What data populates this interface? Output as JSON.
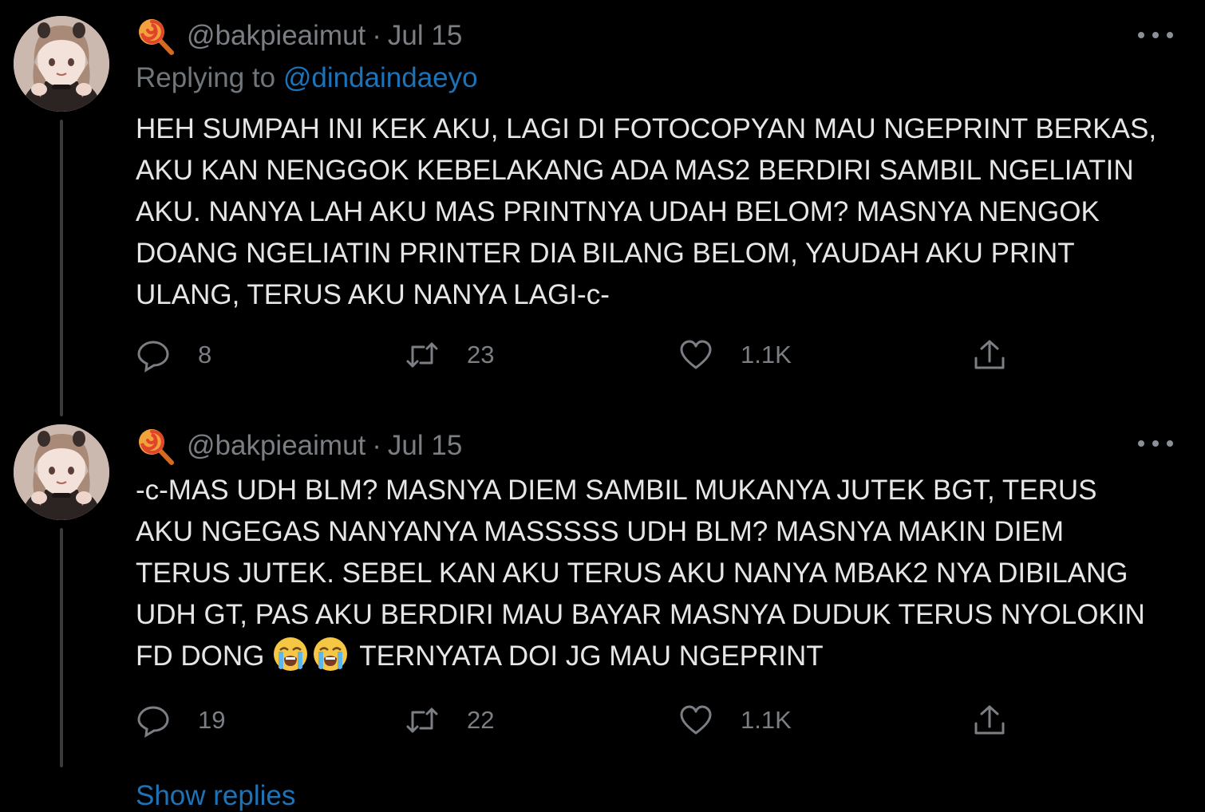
{
  "colors": {
    "background": "#000000",
    "text_primary": "#e6e6e6",
    "text_secondary": "#7b7f84",
    "link": "#1d73b8",
    "thread_line": "#3a3a3a"
  },
  "tweets": [
    {
      "handle": "@bakpieaimut",
      "separator": "·",
      "date": "Jul 15",
      "replying_label": "Replying to",
      "replying_to": "@dindaindaeyo",
      "lines": [
        "HEH SUMPAH INI KEK AKU, LAGI DI FOTOCOPYAN MAU NGEPRINT BERKAS,",
        "AKU KAN NENGGOK KEBELAKANG ADA MAS2 BERDIRI SAMBIL NGELIATIN",
        "AKU. NANYA LAH AKU MAS PRINTNYA UDAH BELOM? MASNYA NENGOK",
        "DOANG NGELIATIN PRINTER DIA BILANG BELOM, YAUDAH AKU PRINT",
        "ULANG, TERUS AKU NANYA LAGI-c-"
      ],
      "replies": "8",
      "retweets": "23",
      "likes": "1.1K",
      "icons": [
        "lollipop-icon",
        "more-icon",
        "reply-icon",
        "retweet-icon",
        "like-icon",
        "share-icon"
      ]
    },
    {
      "handle": "@bakpieaimut",
      "separator": "·",
      "date": "Jul 15",
      "lines": [
        "-c-MAS UDH BLM? MASNYA DIEM SAMBIL MUKANYA JUTEK BGT, TERUS",
        "AKU NGEGAS NANYANYA MASSSSS UDH BLM? MASNYA MAKIN DIEM",
        "TERUS JUTEK. SEBEL KAN AKU TERUS AKU NANYA MBAK2 NYA DIBILANG",
        "UDH GT, PAS AKU BERDIRI MAU BAYAR MASNYA DUDUK TERUS NYOLOKIN"
      ],
      "last_line_start": "FD DONG",
      "last_line_end": "TERNYATA DOI JG MAU NGEPRINT",
      "replies": "19",
      "retweets": "22",
      "likes": "1.1K",
      "emoji": [
        "loudly-crying-face-emoji",
        "loudly-crying-face-emoji"
      ]
    }
  ],
  "show_replies": "Show replies"
}
